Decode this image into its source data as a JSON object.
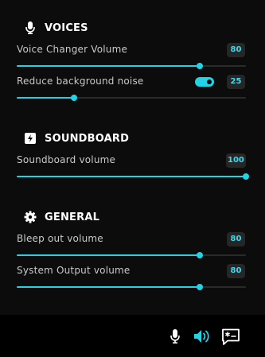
{
  "colors": {
    "accent": "#22d3e6",
    "background": "#0c0c0c",
    "footer_background": "#000000",
    "track": "#2a2a2a",
    "badge_background": "#262626",
    "badge_text": "#3fd9ee"
  },
  "voices": {
    "title": "VOICES",
    "icon": "microphone-icon",
    "voice_changer": {
      "label": "Voice Changer Volume",
      "value": "80",
      "level": 0.8
    },
    "noise": {
      "label": "Reduce background noise",
      "value": "25",
      "level": 0.25,
      "toggle_on": true
    }
  },
  "soundboard": {
    "title": "SOUNDBOARD",
    "icon": "lightning-icon",
    "volume": {
      "label": "Soundboard volume",
      "value": "100",
      "level": 1.0
    }
  },
  "general": {
    "title": "GENERAL",
    "icon": "gear-icon",
    "bleep": {
      "label": "Bleep out volume",
      "value": "80",
      "level": 0.8
    },
    "system_output": {
      "label": "System Output volume",
      "value": "80",
      "level": 0.8
    }
  },
  "footer": {
    "icons": [
      "microphone-icon",
      "speaker-icon",
      "chat-icon"
    ],
    "active_icon": "speaker-icon"
  }
}
